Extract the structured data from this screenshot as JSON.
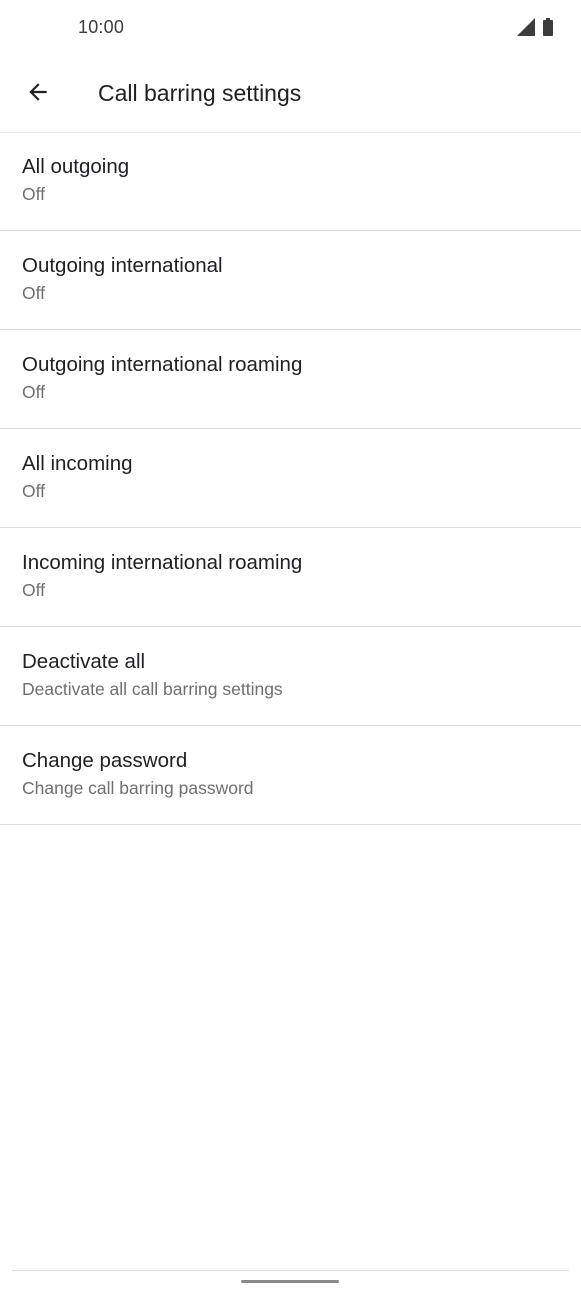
{
  "status_bar": {
    "time": "10:00",
    "icons": [
      "cell-signal-icon",
      "battery-icon"
    ]
  },
  "app_bar": {
    "back_icon": "arrow-back-icon",
    "title": "Call barring settings"
  },
  "settings": {
    "items": [
      {
        "title": "All outgoing",
        "summary": "Off"
      },
      {
        "title": "Outgoing international",
        "summary": "Off"
      },
      {
        "title": "Outgoing international roaming",
        "summary": "Off"
      },
      {
        "title": "All incoming",
        "summary": "Off"
      },
      {
        "title": "Incoming international roaming",
        "summary": "Off"
      },
      {
        "title": "Deactivate all",
        "summary": "Deactivate all call barring settings"
      },
      {
        "title": "Change password",
        "summary": "Change call barring password"
      }
    ]
  },
  "colors": {
    "text_primary": "#202124",
    "text_secondary": "#6f6f6f",
    "divider": "#dcdcdc",
    "background": "#ffffff"
  }
}
